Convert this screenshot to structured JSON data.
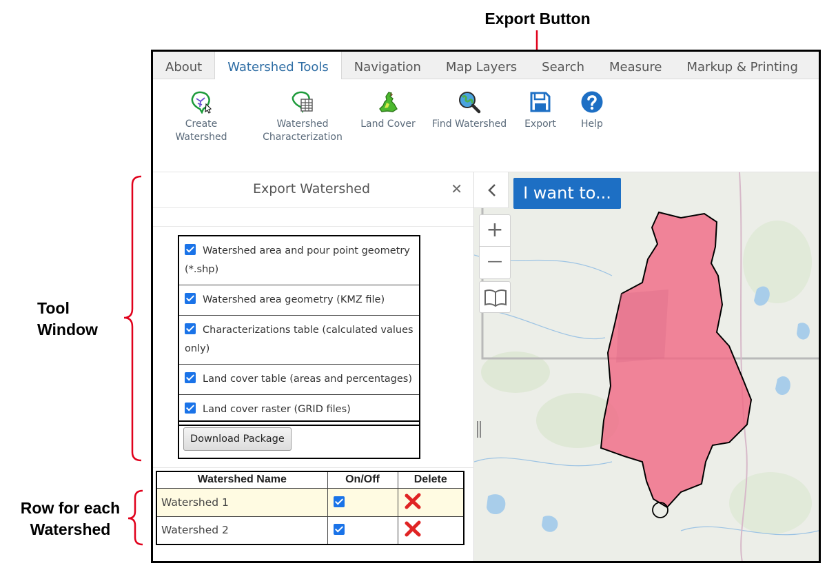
{
  "annotations": {
    "export_button": "Export Button",
    "tool_window_line1": "Tool",
    "tool_window_line2": "Window",
    "row_line1": "Row for each",
    "row_line2": "Watershed"
  },
  "tabs": [
    {
      "label": "About"
    },
    {
      "label": "Watershed Tools"
    },
    {
      "label": "Navigation"
    },
    {
      "label": "Map Layers"
    },
    {
      "label": "Search"
    },
    {
      "label": "Measure"
    },
    {
      "label": "Markup & Printing"
    }
  ],
  "active_tab": "Watershed Tools",
  "toolbar": {
    "create_line1": "Create",
    "create_line2": "Watershed",
    "char_line1": "Watershed",
    "char_line2": "Characterization",
    "land_cover": "Land Cover",
    "find_watershed": "Find Watershed",
    "export": "Export",
    "help": "Help"
  },
  "panel": {
    "title": "Export Watershed",
    "close": "✕",
    "options": [
      {
        "label": "Watershed area and pour point geometry (*.shp)",
        "checked": true
      },
      {
        "label": "Watershed area geometry (KMZ file)",
        "checked": true
      },
      {
        "label": "Characterizations table (calculated values only)",
        "checked": true
      },
      {
        "label": "Land cover table (areas and percentages)",
        "checked": true
      },
      {
        "label": "Land cover raster (GRID files)",
        "checked": true
      }
    ],
    "download_label": "Download Package"
  },
  "table": {
    "headers": [
      "Watershed Name",
      "On/Off",
      "Delete"
    ],
    "rows": [
      {
        "name": "Watershed 1",
        "on": true,
        "selected": true
      },
      {
        "name": "Watershed 2",
        "on": true,
        "selected": false
      }
    ]
  },
  "map": {
    "collapse": "<",
    "i_want_to": "I want to...",
    "zoom_in": "+",
    "zoom_out": "—"
  },
  "colors": {
    "accent": "#2e6da4",
    "button_blue": "#1d6fc4",
    "annotation_red": "#e0001b",
    "watershed_fill": "#f06b86"
  }
}
